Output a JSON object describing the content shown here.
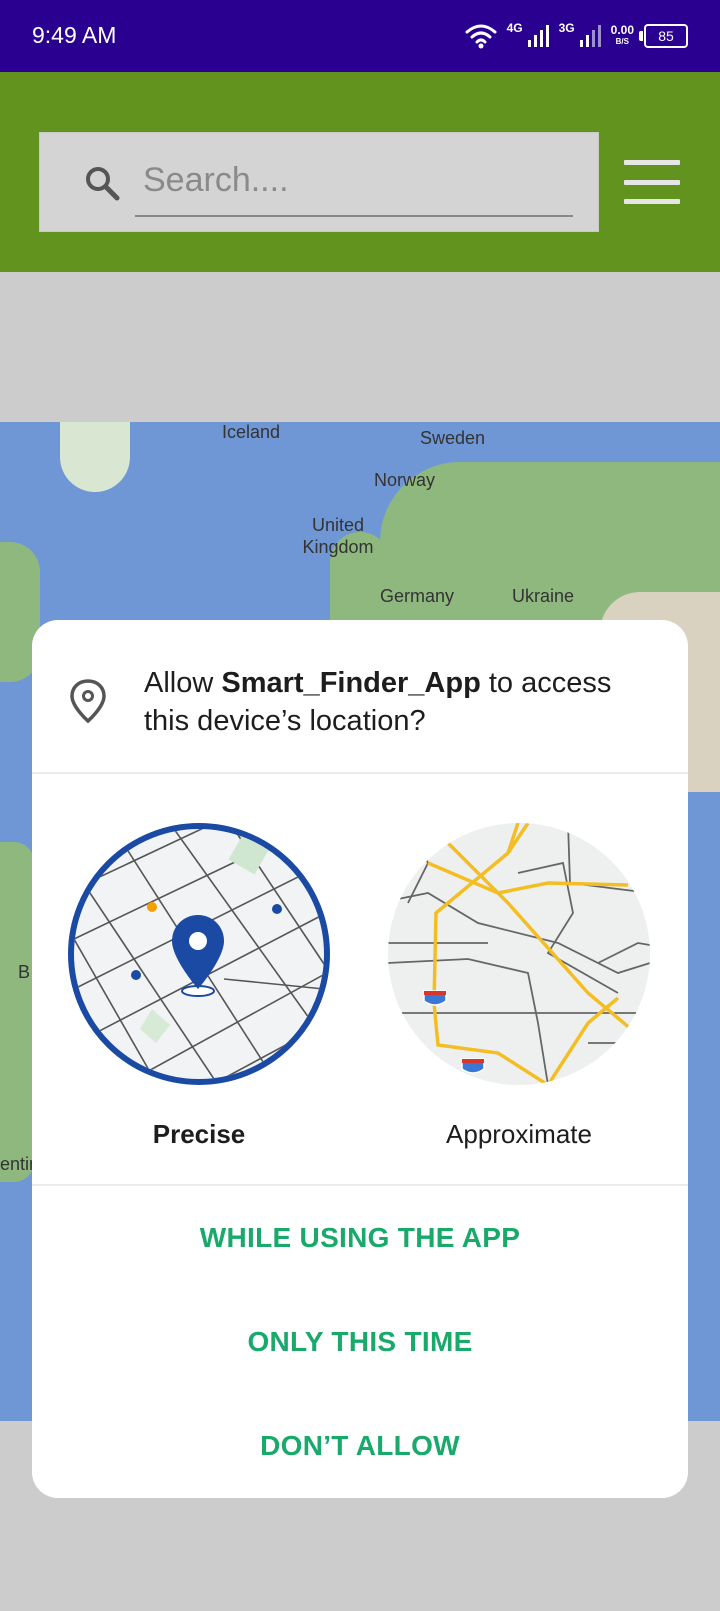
{
  "status_bar": {
    "time": "9:49 AM",
    "net1": "4G",
    "net2": "3G",
    "speed_value": "0.00",
    "speed_unit": "B/S",
    "battery": "85"
  },
  "search": {
    "placeholder": "Search...."
  },
  "map": {
    "labels": [
      "Iceland",
      "Sweden",
      "Norway",
      "United Kingdom",
      "Germany",
      "Ukraine",
      "B",
      "entin"
    ]
  },
  "dialog": {
    "title_prefix": "Allow ",
    "app_name": "Smart_Finder_App",
    "title_suffix": " to access this device’s location?",
    "options": [
      {
        "label": "Precise",
        "selected": true
      },
      {
        "label": "Approximate",
        "selected": false
      }
    ],
    "buttons": {
      "while_using": "WHILE USING THE APP",
      "only_this_time": "ONLY THIS TIME",
      "dont_allow": "DON’T ALLOW"
    }
  },
  "colors": {
    "status_bar": "#29008f",
    "app_bar": "#63931f",
    "accent": "#18a96b",
    "precise_ring": "#1a4aa3",
    "map_water": "#6f97d6"
  }
}
